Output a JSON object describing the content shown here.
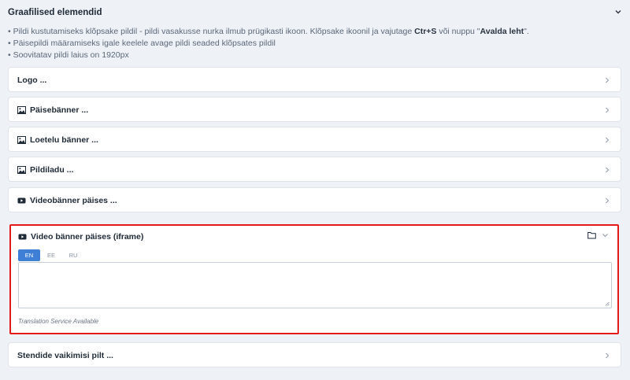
{
  "section": {
    "title": "Graafilised elemendid"
  },
  "notes": {
    "line1_a": "Pildi kustutamiseks klõpsake pildil - pildi vasakusse nurka ilmub prügikasti ikoon. Klõpsake ikoonil ja vajutage ",
    "line1_b": "Ctr+S",
    "line1_c": " või nuppu \"",
    "line1_d": "Avalda leht",
    "line1_e": "\".",
    "line2": "Päisepildi määramiseks igale keelele avage pildi seaded klõpsates pildil",
    "line3": "Soovitatav pildi laius on 1920px"
  },
  "panels": [
    {
      "label": "Logo ...",
      "icon": "none"
    },
    {
      "label": "Päisebänner ...",
      "icon": "image-icon"
    },
    {
      "label": "Loetelu bänner ...",
      "icon": "image-icon"
    },
    {
      "label": "Pildiladu ...",
      "icon": "image-icon"
    },
    {
      "label": "Videobänner päises ...",
      "icon": "youtube-icon"
    }
  ],
  "active_panel": {
    "label": "Video bänner päises (iframe)",
    "tabs": [
      "EN",
      "EE",
      "RU"
    ],
    "selected_tab": "EN",
    "textarea_value": "",
    "service_note": "Translation Service Available"
  },
  "last_panel": {
    "label": "Stendide vaikimisi pilt ..."
  },
  "colors": {
    "accent": "#3f7fd5",
    "highlight_border": "#e31b1b",
    "background": "#eef1f6"
  }
}
